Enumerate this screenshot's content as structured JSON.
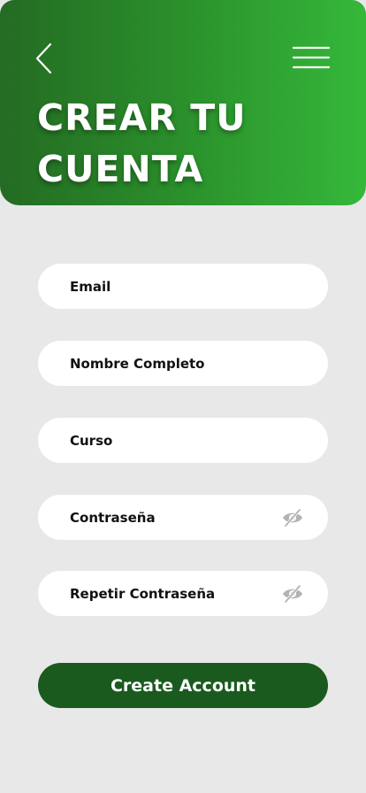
{
  "header": {
    "title_line1": "CREAR TU",
    "title_line2": "CUENTA",
    "back_icon": "chevron-left-icon",
    "menu_icon": "hamburger-menu-icon",
    "gradient_start": "#246b23",
    "gradient_end": "#35b83a"
  },
  "form": {
    "email_placeholder": "Email",
    "name_placeholder": "Nombre Completo",
    "course_placeholder": "Curso",
    "password_placeholder": "Contraseña",
    "repeat_password_placeholder": "Repetir Contraseña",
    "password_visibility_icon": "eye-off-icon"
  },
  "actions": {
    "create_label": "Create Account",
    "button_color": "#1b5a1f"
  }
}
